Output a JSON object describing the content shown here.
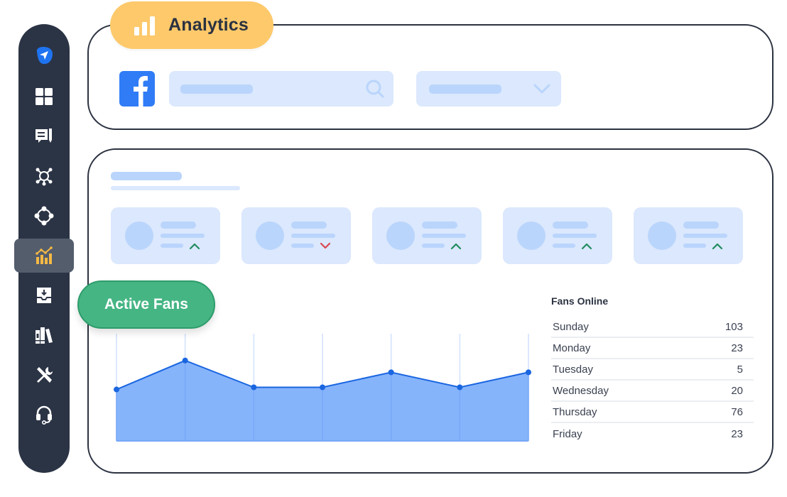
{
  "sidebar": {
    "items": [
      {
        "name": "send",
        "icon": "paper-plane-icon",
        "active": false
      },
      {
        "name": "dashboard",
        "icon": "grid-icon",
        "active": false
      },
      {
        "name": "messages",
        "icon": "comment-edit-icon",
        "active": false
      },
      {
        "name": "network",
        "icon": "network-hub-icon",
        "active": false
      },
      {
        "name": "connections",
        "icon": "nodes-circle-icon",
        "active": false
      },
      {
        "name": "analytics",
        "icon": "analytics-chart-icon",
        "active": true
      },
      {
        "name": "inbox",
        "icon": "inbox-download-icon",
        "active": false
      },
      {
        "name": "library",
        "icon": "books-icon",
        "active": false
      },
      {
        "name": "tools",
        "icon": "wrench-screwdriver-icon",
        "active": false
      },
      {
        "name": "support",
        "icon": "headset-icon",
        "active": false
      }
    ],
    "active_color": "#f5b944"
  },
  "header": {
    "title": "Analytics",
    "title_icon": "bar-chart-icon",
    "platform_icon": "facebook-icon",
    "search_icon": "search-icon",
    "dropdown_icon": "chevron-down-icon"
  },
  "stat_cards": [
    {
      "trend": "up"
    },
    {
      "trend": "down"
    },
    {
      "trend": "up"
    },
    {
      "trend": "up"
    },
    {
      "trend": "up"
    }
  ],
  "colors": {
    "trend_up": "#1f8c5e",
    "trend_down": "#d9474f",
    "chart_line": "#1a66e0",
    "chart_fill": "#86b4fb",
    "accent_yellow": "#fdc96b",
    "accent_green": "#45b584"
  },
  "active_fans": {
    "label": "Active Fans"
  },
  "chart_data": {
    "type": "area",
    "title": "Active Fans",
    "x": [
      1,
      2,
      3,
      4,
      5,
      6,
      7
    ],
    "values": [
      48,
      75,
      50,
      50,
      64,
      50,
      64
    ],
    "ylim": [
      0,
      100
    ],
    "xlabel": "",
    "ylabel": "",
    "grid": "vertical"
  },
  "fans_online": {
    "title": "Fans Online",
    "rows": [
      {
        "day": "Sunday",
        "value": "103"
      },
      {
        "day": "Monday",
        "value": "23"
      },
      {
        "day": "Tuesday",
        "value": "5"
      },
      {
        "day": "Wednesday",
        "value": "20"
      },
      {
        "day": "Thursday",
        "value": "76"
      },
      {
        "day": "Friday",
        "value": "23"
      }
    ]
  }
}
